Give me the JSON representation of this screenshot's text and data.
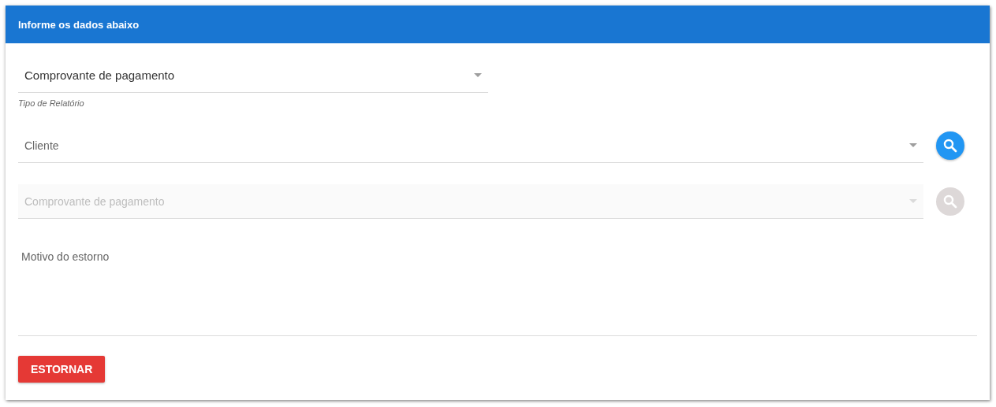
{
  "header": {
    "title": "Informe os dados abaixo"
  },
  "report_type": {
    "value": "Comprovante de pagamento",
    "hint": "Tipo de Relatório"
  },
  "lookups": [
    {
      "placeholder": "Cliente",
      "disabled": false
    },
    {
      "placeholder": "Comprovante de pagamento",
      "disabled": true
    }
  ],
  "reason": {
    "placeholder": "Motivo do estorno"
  },
  "action_button": {
    "label": "ESTORNAR"
  }
}
